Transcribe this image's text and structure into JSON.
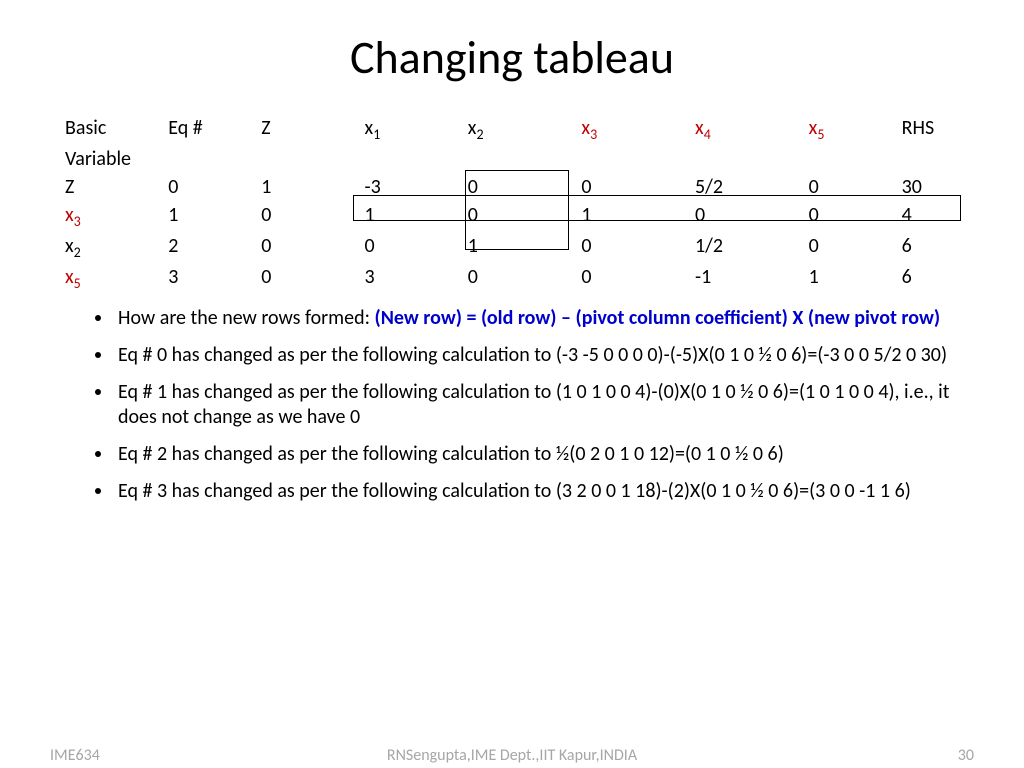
{
  "title": "Changing tableau",
  "table": {
    "headers": [
      "Basic",
      "Eq #",
      "Z",
      "x1",
      "x2",
      "x3",
      "x4",
      "x5",
      "RHS"
    ],
    "redHeaderIdx": [
      5,
      6,
      7
    ],
    "subheader": "Variable",
    "rows": [
      {
        "label": "Z",
        "red": false,
        "cells": [
          "0",
          "1",
          "-3",
          "0",
          "0",
          "5/2",
          "0",
          "30"
        ]
      },
      {
        "label": "x3",
        "red": true,
        "cells": [
          "1",
          "0",
          "1",
          "0",
          "1",
          "0",
          "0",
          "4"
        ]
      },
      {
        "label": "x2",
        "red": false,
        "cells": [
          "2",
          "0",
          "0",
          "1",
          "0",
          "1/2",
          "0",
          "6"
        ]
      },
      {
        "label": "x5",
        "red": true,
        "cells": [
          "3",
          "0",
          "3",
          "0",
          "0",
          "-1",
          "1",
          "6"
        ]
      }
    ]
  },
  "notes": {
    "item0_prefix": "How are the new rows formed: ",
    "item0_formula": "(New row) = (old row) – (pivot column coefficient) X (new pivot row)",
    "item1": "Eq # 0 has changed as per the following calculation to (-3 -5 0 0 0 0)-(-5)X(0 1 0 ½ 0 6)=(-3 0 0 5/2 0 30)",
    "item2": "Eq # 1 has changed as per the following calculation to (1 0 1 0 0 4)-(0)X(0 1 0 ½ 0 6)=(1 0 1 0 0 4), i.e., it does not change as we have 0",
    "item3": "Eq # 2 has changed as per the following calculation to ½(0 2 0 1 0 12)=(0 1 0 ½ 0 6)",
    "item4": "Eq # 3 has changed as per the following calculation to (3 2 0 0 1 18)-(2)X(0 1 0 ½ 0 6)=(3 0 0 -1 1 6)"
  },
  "footer": {
    "left": "IME634",
    "center": "RNSengupta,IME Dept.,IIT Kapur,INDIA",
    "right": "30"
  }
}
